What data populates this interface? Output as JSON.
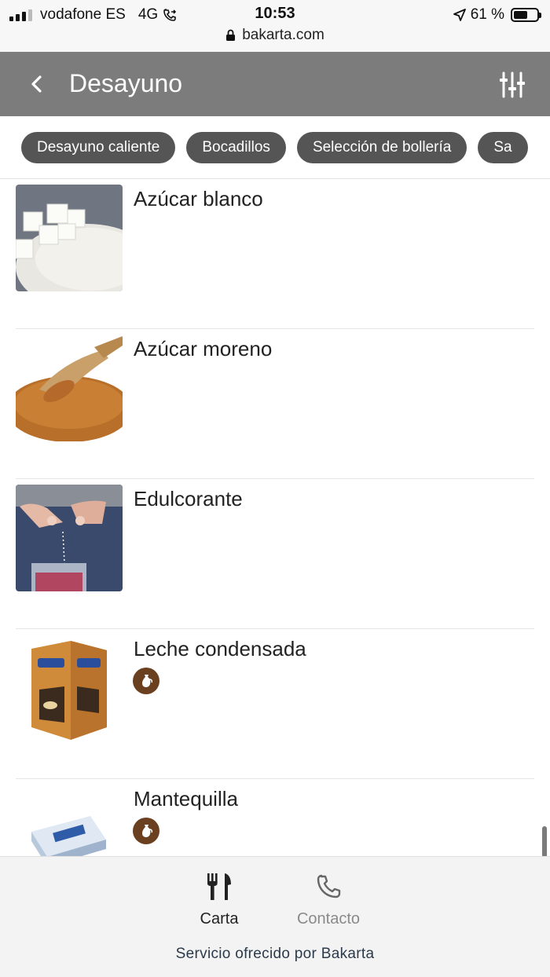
{
  "status_bar": {
    "carrier": "vodafone ES",
    "network": "4G",
    "time": "10:53",
    "battery_text": "61 %",
    "battery_level": 0.61,
    "url": "bakarta.com",
    "icons": [
      "signal-icon",
      "call-forward-icon",
      "location-arrow-icon",
      "battery-icon",
      "lock-icon"
    ]
  },
  "header": {
    "title": "Desayuno",
    "background": "#7c7c7c",
    "icons": [
      "back-chevron-icon",
      "filter-sliders-icon"
    ]
  },
  "categories": [
    "Desayuno caliente",
    "Bocadillos",
    "Selección de bollería",
    "Sa"
  ],
  "products": [
    {
      "name": "Azúcar blanco",
      "image": "white-sugar-cubes",
      "allergens": []
    },
    {
      "name": "Azúcar moreno",
      "image": "brown-sugar-scoop",
      "allergens": []
    },
    {
      "name": "Edulcorante",
      "image": "sweetener-glass",
      "allergens": []
    },
    {
      "name": "Leche condensada",
      "image": "condensed-milk-box",
      "allergens": [
        "milk-jug-icon"
      ]
    },
    {
      "name": "Mantequilla",
      "image": "butter-portion",
      "allergens": [
        "milk-jug-icon"
      ]
    }
  ],
  "allergen_color": "#6b4021",
  "bottom_nav": {
    "items": [
      {
        "label": "Carta",
        "icon": "fork-knife-icon",
        "active": true
      },
      {
        "label": "Contacto",
        "icon": "phone-icon",
        "active": false
      }
    ],
    "footer": "Servicio ofrecido por Bakarta"
  }
}
